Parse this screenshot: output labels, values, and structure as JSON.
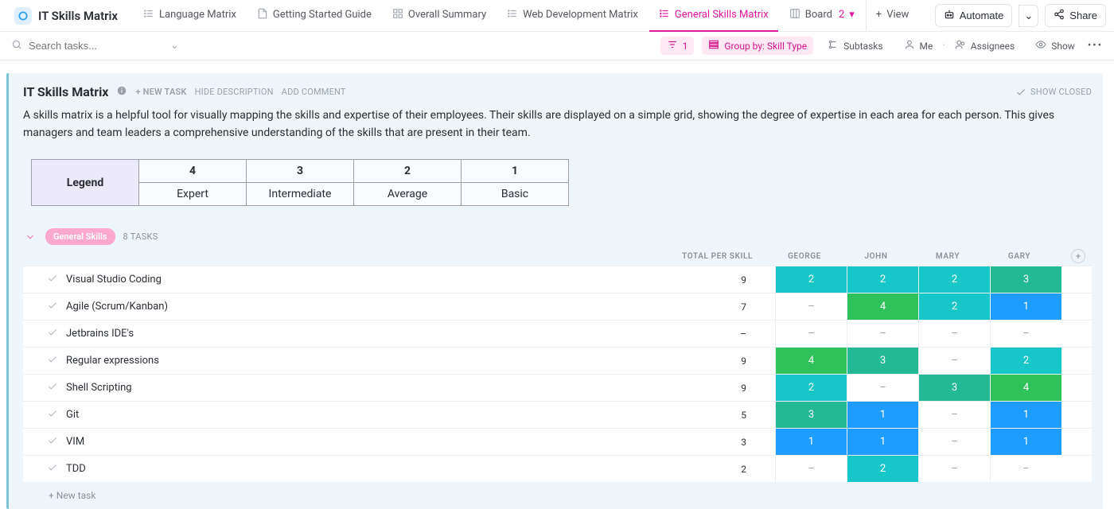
{
  "workspace": {
    "title": "IT Skills Matrix"
  },
  "tabs": [
    {
      "label": "Language Matrix",
      "icon": "list"
    },
    {
      "label": "Getting Started Guide",
      "icon": "doc"
    },
    {
      "label": "Overall Summary",
      "icon": "grid"
    },
    {
      "label": "Web Development Matrix",
      "icon": "list"
    },
    {
      "label": "General Skills Matrix",
      "icon": "list",
      "active": true
    },
    {
      "label": "Board",
      "icon": "board",
      "count": "2"
    }
  ],
  "topbar": {
    "view": "View",
    "automate": "Automate",
    "share": "Share"
  },
  "toolbar": {
    "search_placeholder": "Search tasks...",
    "filter_count": "1",
    "group_by_label": "Group by: Skill Type",
    "subtasks": "Subtasks",
    "me": "Me",
    "assignees": "Assignees",
    "show": "Show"
  },
  "card": {
    "title": "IT Skills Matrix",
    "new_task": "+ NEW TASK",
    "hide_desc": "HIDE DESCRIPTION",
    "add_comment": "ADD COMMENT",
    "show_closed": "SHOW CLOSED",
    "description": "A skills matrix is a helpful tool for visually mapping the skills and expertise of their employees. Their skills are displayed on a simple grid, showing the degree of expertise in each area for each person. This gives managers and team leaders a comprehensive understanding of the skills that are present in their team."
  },
  "legend": {
    "header": "Legend",
    "levels": [
      {
        "num": "4",
        "label": "Expert"
      },
      {
        "num": "3",
        "label": "Intermediate"
      },
      {
        "num": "2",
        "label": "Average"
      },
      {
        "num": "1",
        "label": "Basic"
      }
    ]
  },
  "group": {
    "name": "General Skills",
    "count_label": "8 TASKS"
  },
  "columns": {
    "total": "TOTAL PER SKILL",
    "people": [
      "GEORGE",
      "JOHN",
      "MARY",
      "GARY"
    ]
  },
  "rows": [
    {
      "name": "Visual Studio Coding",
      "total": "9",
      "cells": [
        "2",
        "2",
        "2",
        "3"
      ]
    },
    {
      "name": "Agile (Scrum/Kanban)",
      "total": "7",
      "cells": [
        "–",
        "4",
        "2",
        "1"
      ]
    },
    {
      "name": "Jetbrains IDE's",
      "total": "–",
      "cells": [
        "–",
        "–",
        "–",
        "–"
      ]
    },
    {
      "name": "Regular expressions",
      "total": "9",
      "cells": [
        "4",
        "3",
        "–",
        "2"
      ]
    },
    {
      "name": "Shell Scripting",
      "total": "9",
      "cells": [
        "2",
        "–",
        "3",
        "4"
      ]
    },
    {
      "name": "Git",
      "total": "5",
      "cells": [
        "3",
        "1",
        "–",
        "1"
      ]
    },
    {
      "name": "VIM",
      "total": "3",
      "cells": [
        "1",
        "1",
        "–",
        "1"
      ]
    },
    {
      "name": "TDD",
      "total": "2",
      "cells": [
        "–",
        "2",
        "–",
        "–"
      ]
    }
  ],
  "footer": {
    "new_task": "+ New task"
  }
}
